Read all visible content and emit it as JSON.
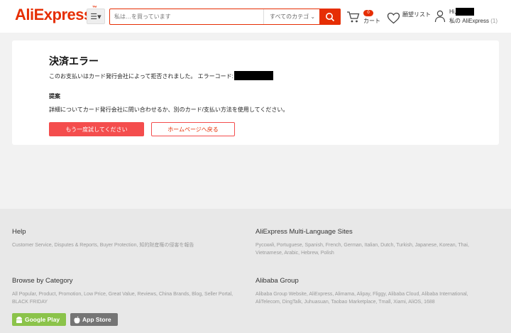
{
  "header": {
    "logo": "AliExpress",
    "search_placeholder": "私は…を買っています",
    "category_label": "すべてのカテゴ",
    "cart_count": "0",
    "cart_label": "カート",
    "wishlist_label": "願望リスト",
    "greeting": "Hi,",
    "account_label": "私の AliExpress",
    "account_count": "(1)"
  },
  "error": {
    "title": "決済エラー",
    "message": "このお支払いはカード発行会社によって拒否されました。 エラーコード:",
    "suggestion_title": "提案",
    "suggestion": "詳細についてカード発行会社に問い合わせるか、別のカード/支払い方法を使用してください。",
    "retry_label": "もう一度試してください",
    "home_label": "ホームページへ戻る"
  },
  "footer": {
    "help_title": "Help",
    "help_links": "Customer Service, Disputes & Reports, Buyer Protection, 知的財産権の侵害を報告",
    "lang_title": "AliExpress Multi-Language Sites",
    "lang_links": "Русский, Portuguese, Spanish, French, German, Italian, Dutch, Turkish, Japanese, Korean, Thai, Vietnamese, Arabic, Hebrew, Polish",
    "browse_title": "Browse by Category",
    "browse_links": "All Popular, Product, Promotion, Low Price, Great Value, Reviews, China Brands, Blog, Seller Portal, BLACK FRIDAY",
    "alibaba_title": "Alibaba Group",
    "alibaba_links": "Alibaba Group Website, AliExpress, Alimama, Alipay, Fliggy, Alibaba Cloud, Alibaba International, AliTelecom, DingTalk, Juhuasuan, Taobao Marketplace, Tmall, Xiami, AliOS, 1688",
    "google_play": "Google Play",
    "app_store": "App Store"
  },
  "colors": {
    "brand": "#e62e04",
    "retry": "#f44d4d"
  },
  "icons": [
    "menu-icon",
    "search-icon",
    "cart-icon",
    "heart-icon",
    "user-icon",
    "android-icon",
    "apple-icon"
  ]
}
